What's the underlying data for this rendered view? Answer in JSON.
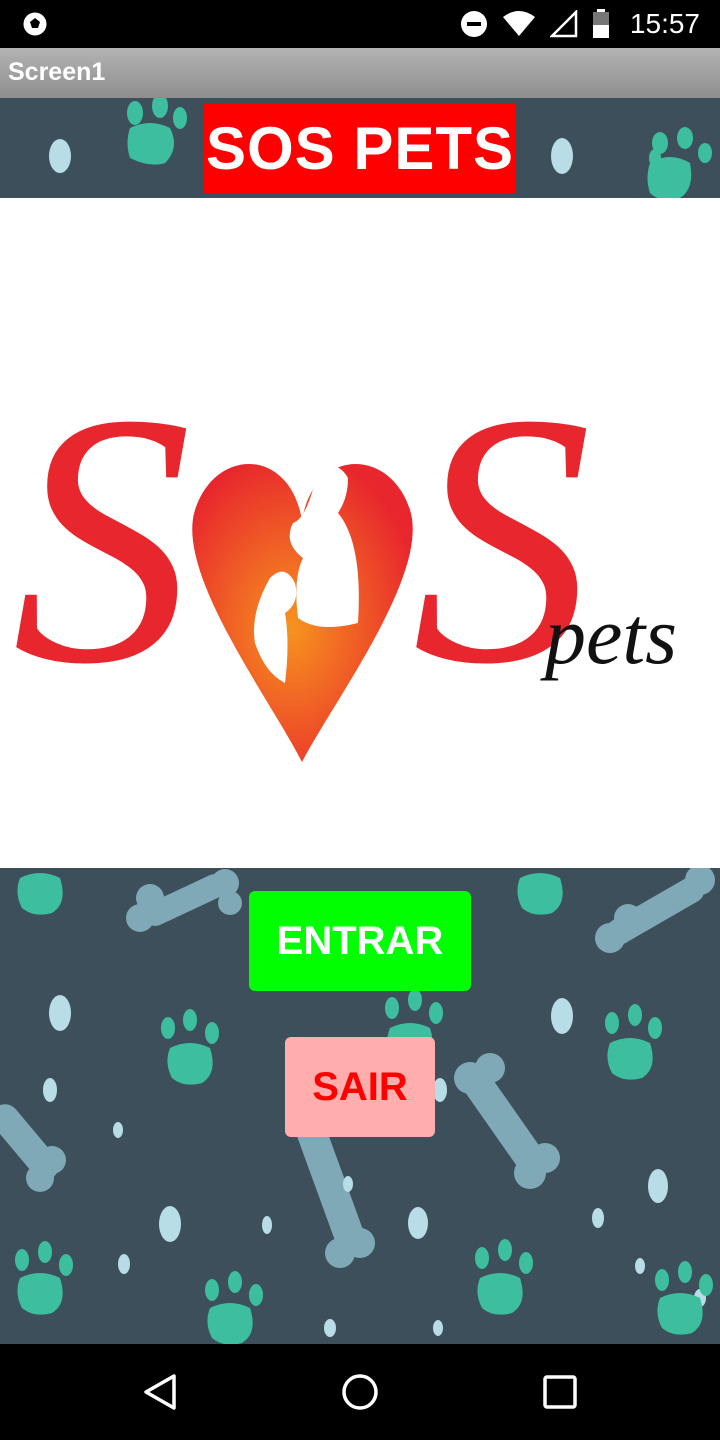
{
  "status_bar": {
    "time": "15:57",
    "icons": [
      "soccer-ball-icon",
      "do-not-disturb-icon",
      "wifi-icon",
      "signal-icon",
      "battery-icon"
    ]
  },
  "title_bar": {
    "title": "Screen1"
  },
  "header": {
    "title": "SOS PETS",
    "background": "#ff0000"
  },
  "logo": {
    "letters_left": "S",
    "letters_right": "S",
    "tagline": "pets"
  },
  "buttons": {
    "enter": {
      "label": "ENTRAR",
      "color": "#00ff00"
    },
    "exit": {
      "label": "SAIR",
      "color": "#ffadad"
    }
  },
  "nav_bar": {
    "items": [
      "back-icon",
      "home-icon",
      "recents-icon"
    ]
  }
}
